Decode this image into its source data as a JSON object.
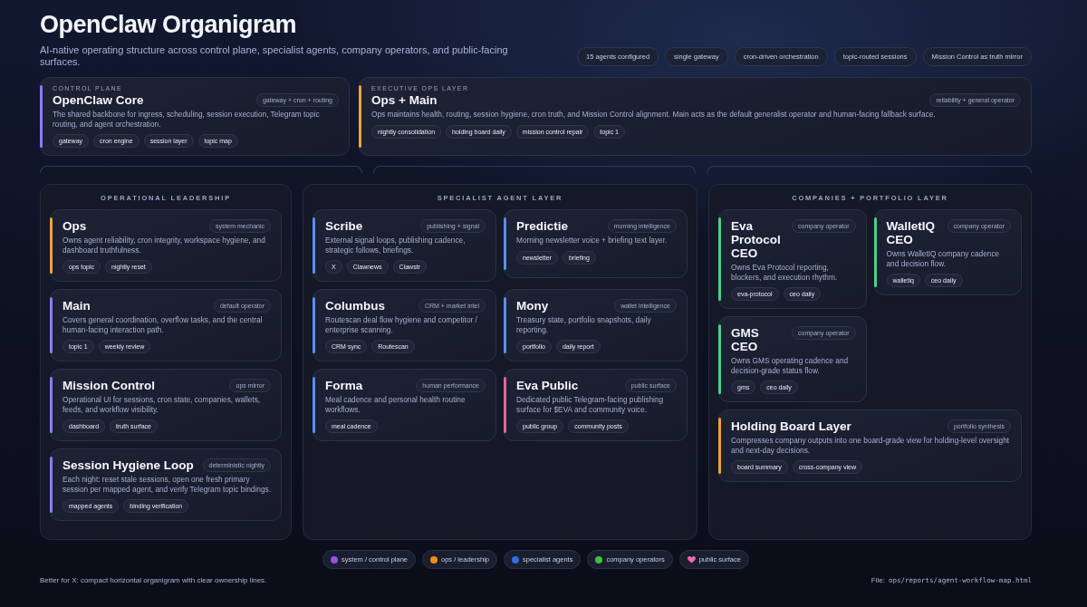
{
  "header": {
    "title": "OpenClaw Organigram",
    "subtitle": "AI-native operating structure across control plane, specialist agents, company operators, and public-facing surfaces.",
    "pills": [
      "15 agents configured",
      "single gateway",
      "cron-driven orchestration",
      "topic-routed sessions",
      "Mission Control as truth mirror"
    ]
  },
  "top_cards": [
    {
      "label": "CONTROL PLANE",
      "title": "OpenClaw Core",
      "tag": "gateway + cron + routing",
      "description": "The shared backbone for ingress, scheduling, session execution, Telegram topic routing, and agent orchestration.",
      "chips": [
        "gateway",
        "cron engine",
        "session layer",
        "topic map"
      ],
      "color": "#8b7cf6"
    },
    {
      "label": "EXECUTIVE OPS LAYER",
      "title": "Ops + Main",
      "tag": "reliability + general operator",
      "description": "Ops maintains health, routing, session hygiene, cron truth, and Mission Control alignment. Main acts as the default generalist operator and human-facing fallback surface.",
      "chips": [
        "nightly consolidation",
        "holding board daily",
        "mission control repair",
        "topic 1"
      ],
      "color": "#f0a23a"
    }
  ],
  "layers": [
    {
      "title": "OPERATIONAL LEADERSHIP",
      "kind": "single",
      "cards": [
        {
          "title": "Ops",
          "tag": "system mechanic",
          "description": "Owns agent reliability, cron integrity, workspace hygiene, and dashboard truthfulness.",
          "chips": [
            "ops topic",
            "nightly reset"
          ],
          "color": "#f0a23a",
          "kind": "standard"
        },
        {
          "title": "Main",
          "tag": "default operator",
          "description": "Covers general coordination, overflow tasks, and the central human-facing interaction path.",
          "chips": [
            "topic 1",
            "weekly review"
          ],
          "color": "#8b7cf6",
          "kind": "standard"
        },
        {
          "title": "Mission Control",
          "tag": "ops mirror",
          "description": "Operational UI for sessions, cron state, companies, wallets, feeds, and workflow visibility.",
          "chips": [
            "dashboard",
            "truth surface"
          ],
          "color": "#8b7cf6",
          "kind": "standard"
        },
        {
          "title": "Session Hygiene Loop",
          "tag": "deterministic nightly",
          "description": "Each night: reset stale sessions, open one fresh primary session per mapped agent, and verify Telegram topic bindings.",
          "chips": [
            "mapped agents",
            "binding verification"
          ],
          "color": "#8b7cf6",
          "kind": "standard"
        }
      ]
    },
    {
      "title": "SPECIALIST AGENT LAYER",
      "kind": "grid",
      "cards": [
        {
          "title": "Scribe",
          "tag": "publishing + signal",
          "description": "External signal loops, publishing cadence, strategic follows, briefings.",
          "chips": [
            "X",
            "Clawnews",
            "Clawstr"
          ],
          "color": "#5b8def",
          "kind": "standard"
        },
        {
          "title": "Predictie",
          "tag": "morning intelligence",
          "description": "Morning newsletter voice + briefing text layer.",
          "chips": [
            "newsletter",
            "briefing"
          ],
          "color": "#5b8def",
          "kind": "standard"
        },
        {
          "title": "Columbus",
          "tag": "CRM + market intel",
          "description": "Routescan deal flow hygiene and competitor / enterprise scanning.",
          "chips": [
            "CRM sync",
            "Routescan"
          ],
          "color": "#5b8def",
          "kind": "standard"
        },
        {
          "title": "Mony",
          "tag": "wallet intelligence",
          "description": "Treasury state, portfolio snapshots, daily reporting.",
          "chips": [
            "portfolio",
            "daily report"
          ],
          "color": "#5b8def",
          "kind": "standard"
        },
        {
          "title": "Forma",
          "tag": "human performance",
          "description": "Meal cadence and personal health routine workflows.",
          "chips": [
            "meal cadence"
          ],
          "color": "#5b8def",
          "kind": "standard"
        },
        {
          "title": "Eva Public",
          "tag": "public surface",
          "description": "Dedicated public Telegram-facing publishing surface for $EVA and community voice.",
          "chips": [
            "public group",
            "community posts"
          ],
          "color": "#e8639c",
          "kind": "standard"
        }
      ]
    },
    {
      "title": "COMPANIES + PORTFOLIO LAYER",
      "kind": "grid",
      "cards": [
        {
          "title": "Eva Protocol CEO",
          "tag": "company operator",
          "description": "Owns Eva Protocol reporting, blockers, and execution rhythm.",
          "chips": [
            "eva-protocol",
            "ceo daily"
          ],
          "color": "#4ccf8a",
          "kind": "standard"
        },
        {
          "title": "WalletIQ CEO",
          "tag": "company operator",
          "description": "Owns WalletIQ company cadence and decision flow.",
          "chips": [
            "walletiq",
            "ceo daily"
          ],
          "color": "#4ccf8a",
          "kind": "standard"
        },
        {
          "title": "GMS CEO",
          "tag": "company operator",
          "description": "Owns GMS operating cadence and decision-grade status flow.",
          "chips": [
            "gms",
            "ceo daily"
          ],
          "color": "#4ccf8a",
          "kind": "standard"
        },
        {
          "title": "Holding Board Layer",
          "tag": "portfolio synthesis",
          "description": "Compresses company outputs into one board-grade view for holding-level oversight and next-day decisions.",
          "chips": [
            "board summary",
            "cross-company view"
          ],
          "color": "#f0a23a",
          "kind": "wide"
        }
      ]
    }
  ],
  "legend": [
    {
      "label": "system / control plane",
      "color": "#9b4dea",
      "kind": "dot"
    },
    {
      "label": "ops / leadership",
      "color": "#f28c1e",
      "kind": "dot"
    },
    {
      "label": "specialist agents",
      "color": "#2f6fe0",
      "kind": "dot"
    },
    {
      "label": "company operators",
      "color": "#3fbf3a",
      "kind": "dot"
    },
    {
      "label": "public surface",
      "color": "#f06aa8",
      "kind": "heart"
    }
  ],
  "footer": {
    "note": "Better for X: compact horizontal organigram with clear ownership lines.",
    "file_label": "File:",
    "file_path": "ops/reports/agent-workflow-map.html"
  }
}
